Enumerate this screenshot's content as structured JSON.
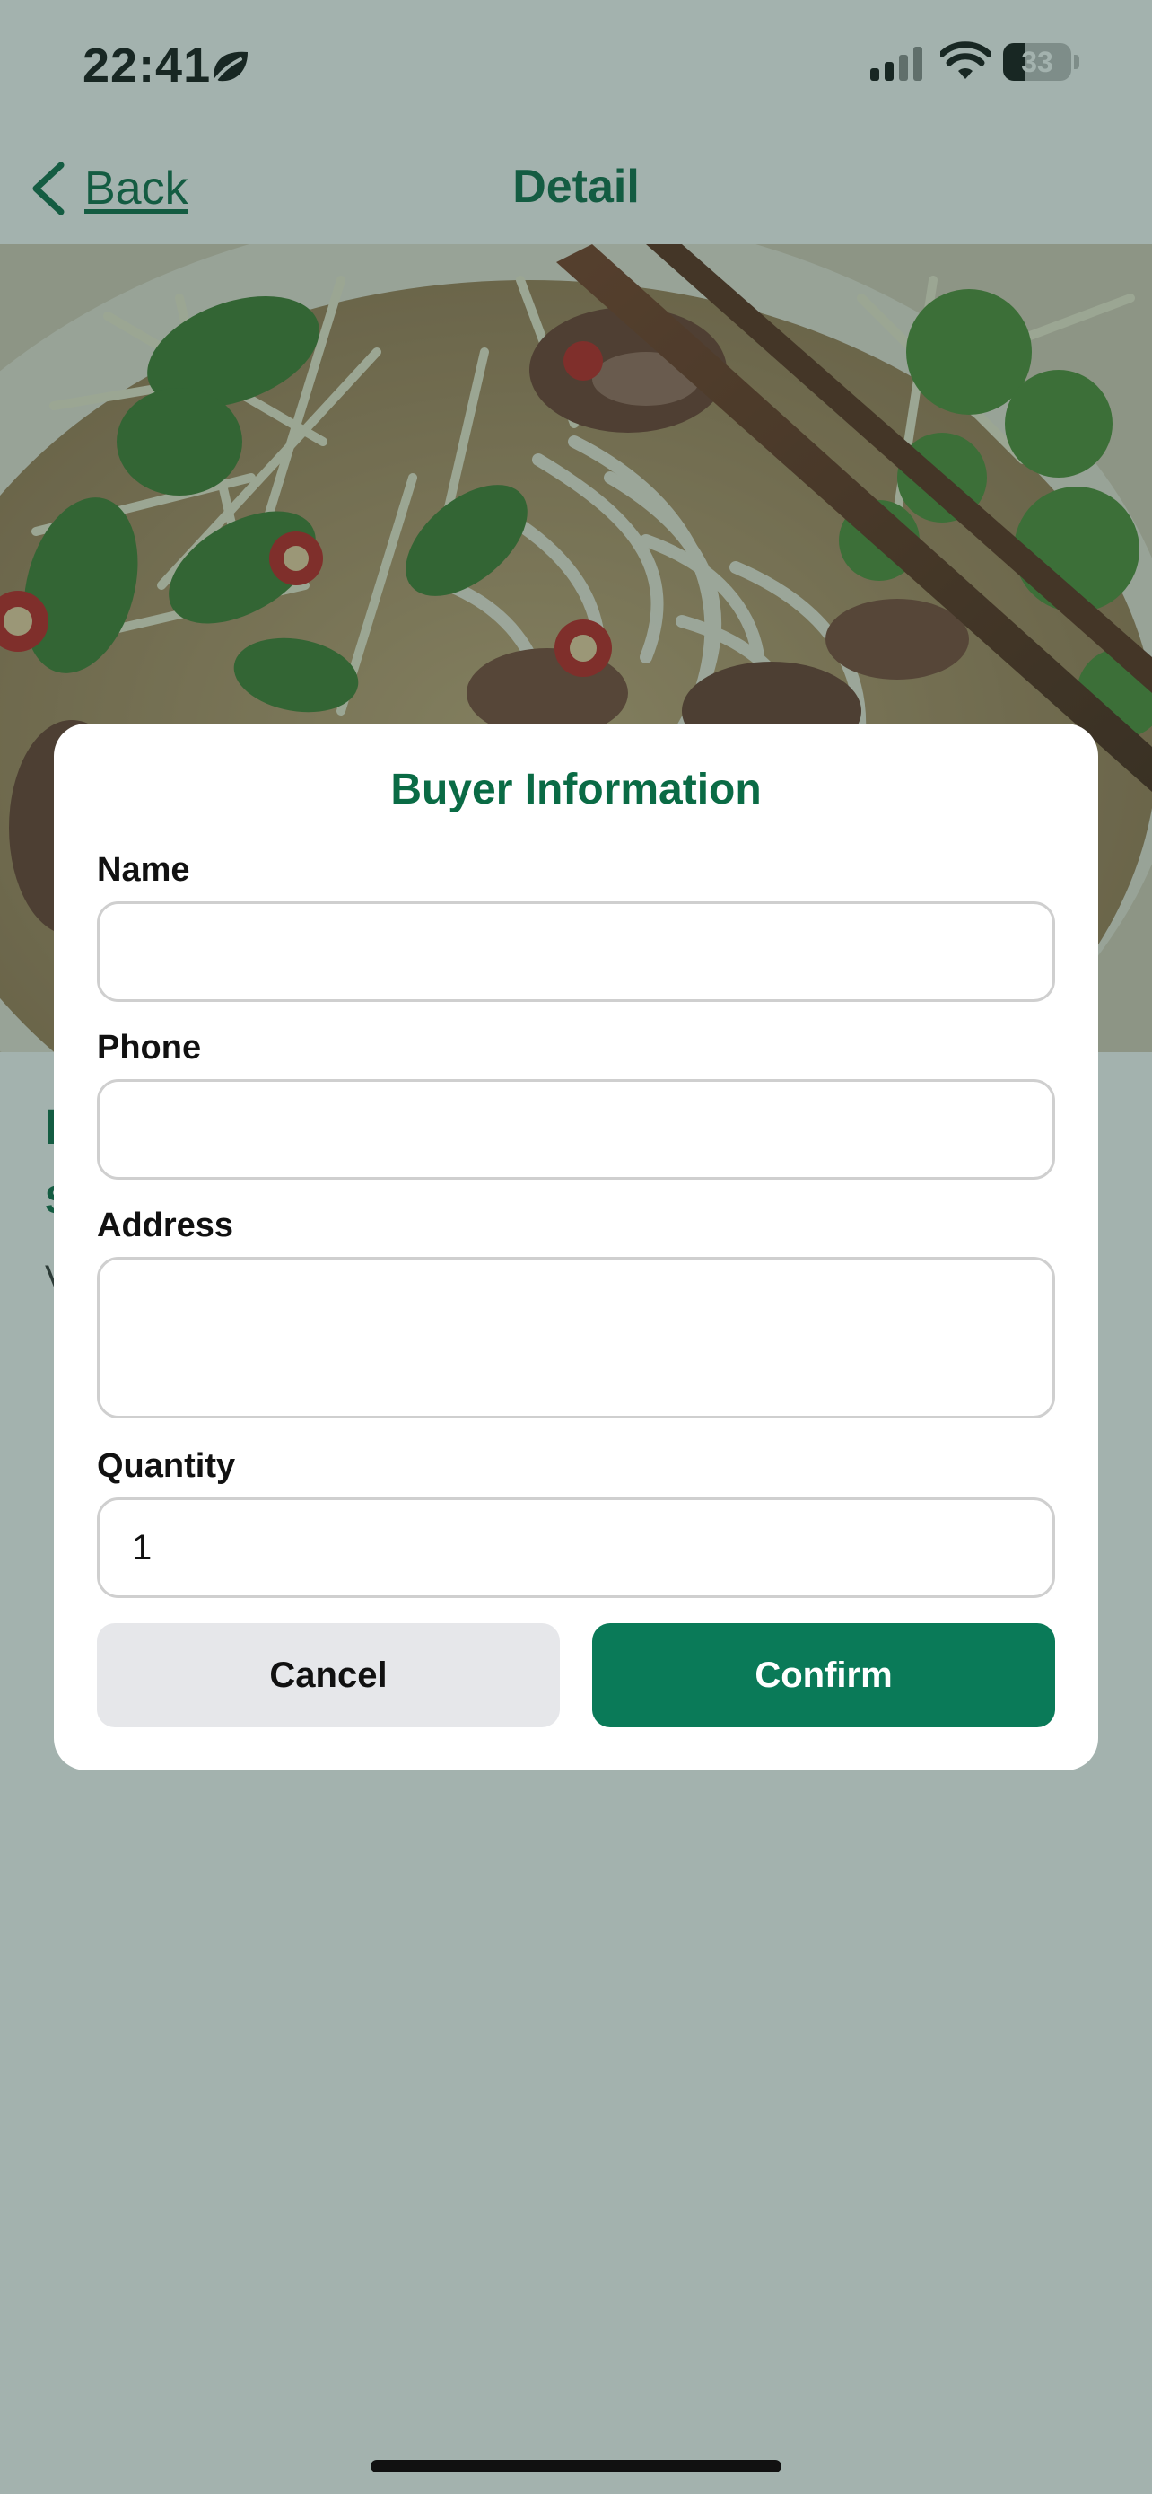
{
  "status_bar": {
    "time": "22:41",
    "battery_level": "33",
    "battery_fraction": 0.33,
    "icons": [
      "leaf-icon",
      "signal-icon",
      "wifi-icon",
      "battery-icon"
    ]
  },
  "nav": {
    "back_label": "Back",
    "title": "Detail",
    "back_icon": "chevron-left-icon"
  },
  "product": {
    "name": "P",
    "price_prefix": "S",
    "desc_prefix": "V"
  },
  "dialog": {
    "title": "Buyer Information",
    "fields": {
      "name": {
        "label": "Name",
        "value": ""
      },
      "phone": {
        "label": "Phone",
        "value": ""
      },
      "address": {
        "label": "Address",
        "value": ""
      },
      "quantity": {
        "label": "Quantity",
        "value": "1"
      }
    },
    "cancel_label": "Cancel",
    "confirm_label": "Confirm"
  },
  "colors": {
    "brand": "#0A6B45",
    "confirm_button": "#0A7A58",
    "cancel_button": "#E6E7EA",
    "overlay": "#23483E"
  }
}
